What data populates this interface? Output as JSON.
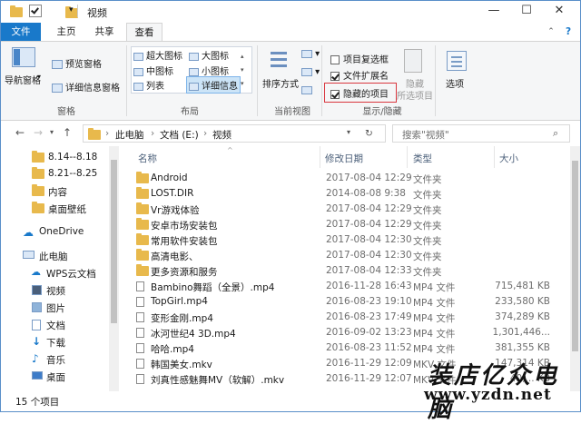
{
  "window": {
    "title": "视频"
  },
  "ribbon_tabs": [
    {
      "label": "文件"
    },
    {
      "label": "主页"
    },
    {
      "label": "共享"
    },
    {
      "label": "查看"
    }
  ],
  "ribbon": {
    "pane": {
      "nav_pane": "导航窗格",
      "preview": "预览窗格",
      "details": "详细信息窗格",
      "group": "窗格"
    },
    "layout": {
      "xl_icons": "超大图标",
      "l_icons": "大图标",
      "m_icons": "中图标",
      "s_icons": "小图标",
      "list": "列表",
      "details": "详细信息",
      "group": "布局"
    },
    "current_view": {
      "sort": "排序方式",
      "group": "当前视图"
    },
    "show_hide": {
      "item_checkbox": "项目复选框",
      "extensions": "文件扩展名",
      "hidden_items": "隐藏的项目",
      "hide_selected_l1": "隐藏",
      "hide_selected_l2": "所选项目",
      "group": "显示/隐藏"
    },
    "options": "选项"
  },
  "address": {
    "root": "此电脑",
    "drive": "文档 (E:)",
    "folder": "视频",
    "search_placeholder": "搜索\"视频\""
  },
  "nav": [
    {
      "label": "8.14--8.18"
    },
    {
      "label": "8.21--8.25"
    },
    {
      "label": "内容"
    },
    {
      "label": "桌面壁纸"
    },
    {
      "label": "OneDrive"
    },
    {
      "label": "此电脑"
    },
    {
      "label": "WPS云文档"
    },
    {
      "label": "视频"
    },
    {
      "label": "图片"
    },
    {
      "label": "文档"
    },
    {
      "label": "下载"
    },
    {
      "label": "音乐"
    },
    {
      "label": "桌面"
    }
  ],
  "columns": {
    "name": "名称",
    "date": "修改日期",
    "type": "类型",
    "size": "大小"
  },
  "files": [
    {
      "name": "Android",
      "date": "2017-08-04 12:29",
      "type": "文件夹",
      "size": ""
    },
    {
      "name": "LOST.DIR",
      "date": "2014-08-08 9:38",
      "type": "文件夹",
      "size": ""
    },
    {
      "name": "Vr游戏体验",
      "date": "2017-08-04 12:29",
      "type": "文件夹",
      "size": ""
    },
    {
      "name": "安卓市场安装包",
      "date": "2017-08-04 12:29",
      "type": "文件夹",
      "size": ""
    },
    {
      "name": "常用软件安装包",
      "date": "2017-08-04 12:30",
      "type": "文件夹",
      "size": ""
    },
    {
      "name": "高清电影、",
      "date": "2017-08-04 12:30",
      "type": "文件夹",
      "size": ""
    },
    {
      "name": "更多资源和服务",
      "date": "2017-08-04 12:33",
      "type": "文件夹",
      "size": ""
    },
    {
      "name": "Bambino舞蹈（全景）.mp4",
      "date": "2016-11-28 16:43",
      "type": "MP4 文件",
      "size": "715,481 KB"
    },
    {
      "name": "TopGirl.mp4",
      "date": "2016-08-23 19:10",
      "type": "MP4 文件",
      "size": "233,580 KB"
    },
    {
      "name": "变形金刚.mp4",
      "date": "2016-08-23 17:49",
      "type": "MP4 文件",
      "size": "374,289 KB"
    },
    {
      "name": "冰河世纪4 3D.mp4",
      "date": "2016-09-02 13:23",
      "type": "MP4 文件",
      "size": "1,301,446..."
    },
    {
      "name": "哈哈.mp4",
      "date": "2016-08-23 11:52",
      "type": "MP4 文件",
      "size": "381,355 KB"
    },
    {
      "name": "韩国美女.mkv",
      "date": "2016-11-29 12:09",
      "type": "MKV 文件",
      "size": "147,314 KB"
    },
    {
      "name": "刘真性感魅舞MV（软解）.mkv",
      "date": "2016-11-29 12:07",
      "type": "MKV 文件",
      "size": "40,... KB"
    }
  ],
  "status": {
    "count": "15 个项目"
  },
  "watermark": {
    "line1": "装店亿众电脑",
    "line2": "www.yzdn.net"
  }
}
